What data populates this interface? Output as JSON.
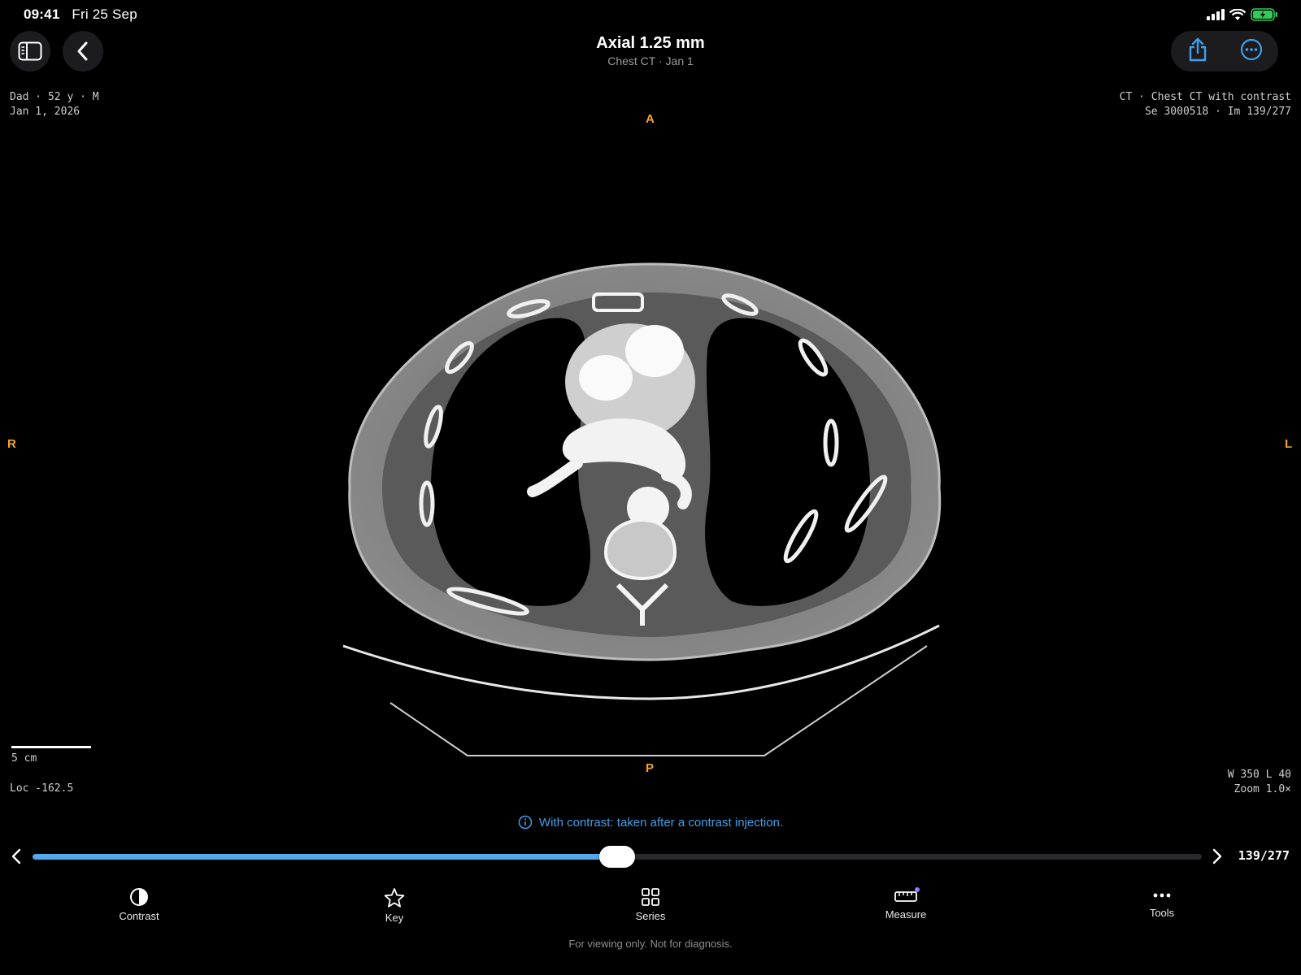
{
  "status": {
    "time": "09:41",
    "date": "Fri 25 Sep"
  },
  "header": {
    "title": "Axial 1.25 mm",
    "subtitle": "Chest CT · Jan 1"
  },
  "overlay": {
    "patient": "Dad · 52 y · M",
    "study_date": "Jan 1, 2026",
    "study_desc": "CT · Chest CT with contrast",
    "series_image": "Se 3000518 · Im 139/277",
    "scale_label": "5 cm",
    "location": "Loc -162.5",
    "window_level": "W 350 L 40",
    "zoom": "Zoom 1.0×",
    "orientation": {
      "top": "A",
      "bottom": "P",
      "left": "R",
      "right": "L"
    }
  },
  "info_text": "With contrast: taken after a contrast injection.",
  "slider": {
    "current": 139,
    "total": 277,
    "label": "139/277"
  },
  "tabs": [
    {
      "label": "Contrast",
      "icon": "contrast-icon"
    },
    {
      "label": "Key",
      "icon": "star-icon"
    },
    {
      "label": "Series",
      "icon": "grid-icon"
    },
    {
      "label": "Measure",
      "icon": "ruler-icon"
    },
    {
      "label": "Tools",
      "icon": "ellipsis-icon"
    }
  ],
  "disclaimer": "For viewing only. Not for diagnosis.",
  "colors": {
    "accent": "#52a9ec",
    "orientation": "#f5a623",
    "info": "#3f9fe8"
  }
}
